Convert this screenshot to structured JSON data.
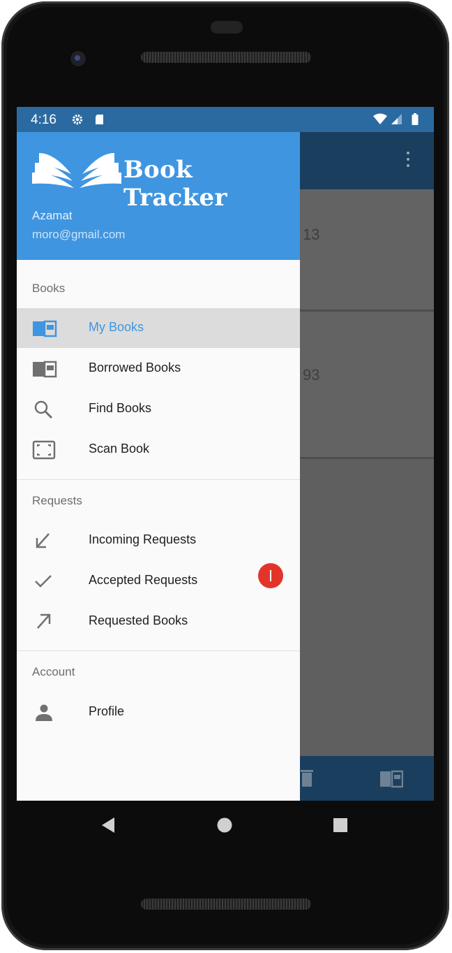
{
  "status_bar": {
    "time": "4:16"
  },
  "drawer": {
    "brand": "Book Tracker",
    "user_name": "Azamat",
    "user_email": "moro@gmail.com",
    "sections": {
      "books": {
        "title": "Books",
        "items": [
          {
            "label": "My Books",
            "icon": "book-icon",
            "active": true
          },
          {
            "label": "Borrowed Books",
            "icon": "book-icon"
          },
          {
            "label": "Find Books",
            "icon": "search-icon"
          },
          {
            "label": "Scan Book",
            "icon": "scan-icon"
          }
        ]
      },
      "requests": {
        "title": "Requests",
        "items": [
          {
            "label": "Incoming Requests",
            "icon": "arrow-down-left-icon"
          },
          {
            "label": "Accepted Requests",
            "icon": "check-icon"
          },
          {
            "label": "Requested Books",
            "icon": "arrow-up-right-icon"
          }
        ]
      },
      "account": {
        "title": "Account",
        "items": [
          {
            "label": "Profile",
            "icon": "person-icon"
          }
        ]
      }
    },
    "badge": {
      "count": "1",
      "color": "#e3342a"
    }
  },
  "background_app": {
    "card1_text": "13",
    "card2_text": "93"
  },
  "colors": {
    "primary": "#3f95e0",
    "status_bar": "#2b6aa1",
    "dark_primary": "#1a3f5e"
  }
}
